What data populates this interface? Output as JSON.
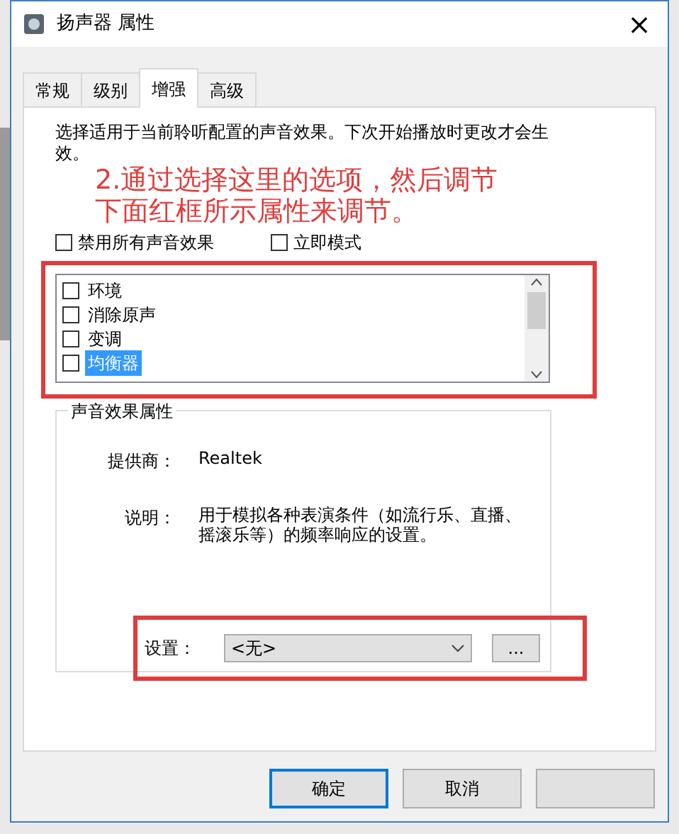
{
  "window": {
    "title": "扬声器 属性",
    "close": "×"
  },
  "tabs": [
    {
      "label": "常规",
      "selected": false
    },
    {
      "label": "级别",
      "selected": false
    },
    {
      "label": "增强",
      "selected": true
    },
    {
      "label": "高级",
      "selected": false
    }
  ],
  "description": "选择适用于当前聆听配置的声音效果。下次开始播放时更改才会生效。",
  "annotation": [
    "2.通过选择这里的选项，然后调节",
    "下面红框所示属性来调节。"
  ],
  "options": [
    {
      "label": "禁用所有声音效果",
      "checked": false
    },
    {
      "label": "立即模式",
      "checked": false
    }
  ],
  "effects": [
    {
      "label": "环境",
      "checked": false,
      "selected": false
    },
    {
      "label": "消除原声",
      "checked": false,
      "selected": false
    },
    {
      "label": "变调",
      "checked": false,
      "selected": false
    },
    {
      "label": "均衡器",
      "checked": false,
      "selected": true
    }
  ],
  "properties": {
    "title": "声音效果属性",
    "rows": [
      {
        "label": "提供商：",
        "value": "Realtek"
      },
      {
        "label": "说明：",
        "value": "用于模拟各种表演条件（如流行乐、直播、摇滚乐等）的频率响应的设置。"
      }
    ]
  },
  "settings": {
    "label": "设置：",
    "value": "<无>",
    "more": "..."
  },
  "buttons": [
    {
      "label": "确定",
      "default": true
    },
    {
      "label": "取消",
      "default": false
    },
    {
      "default": false
    }
  ]
}
